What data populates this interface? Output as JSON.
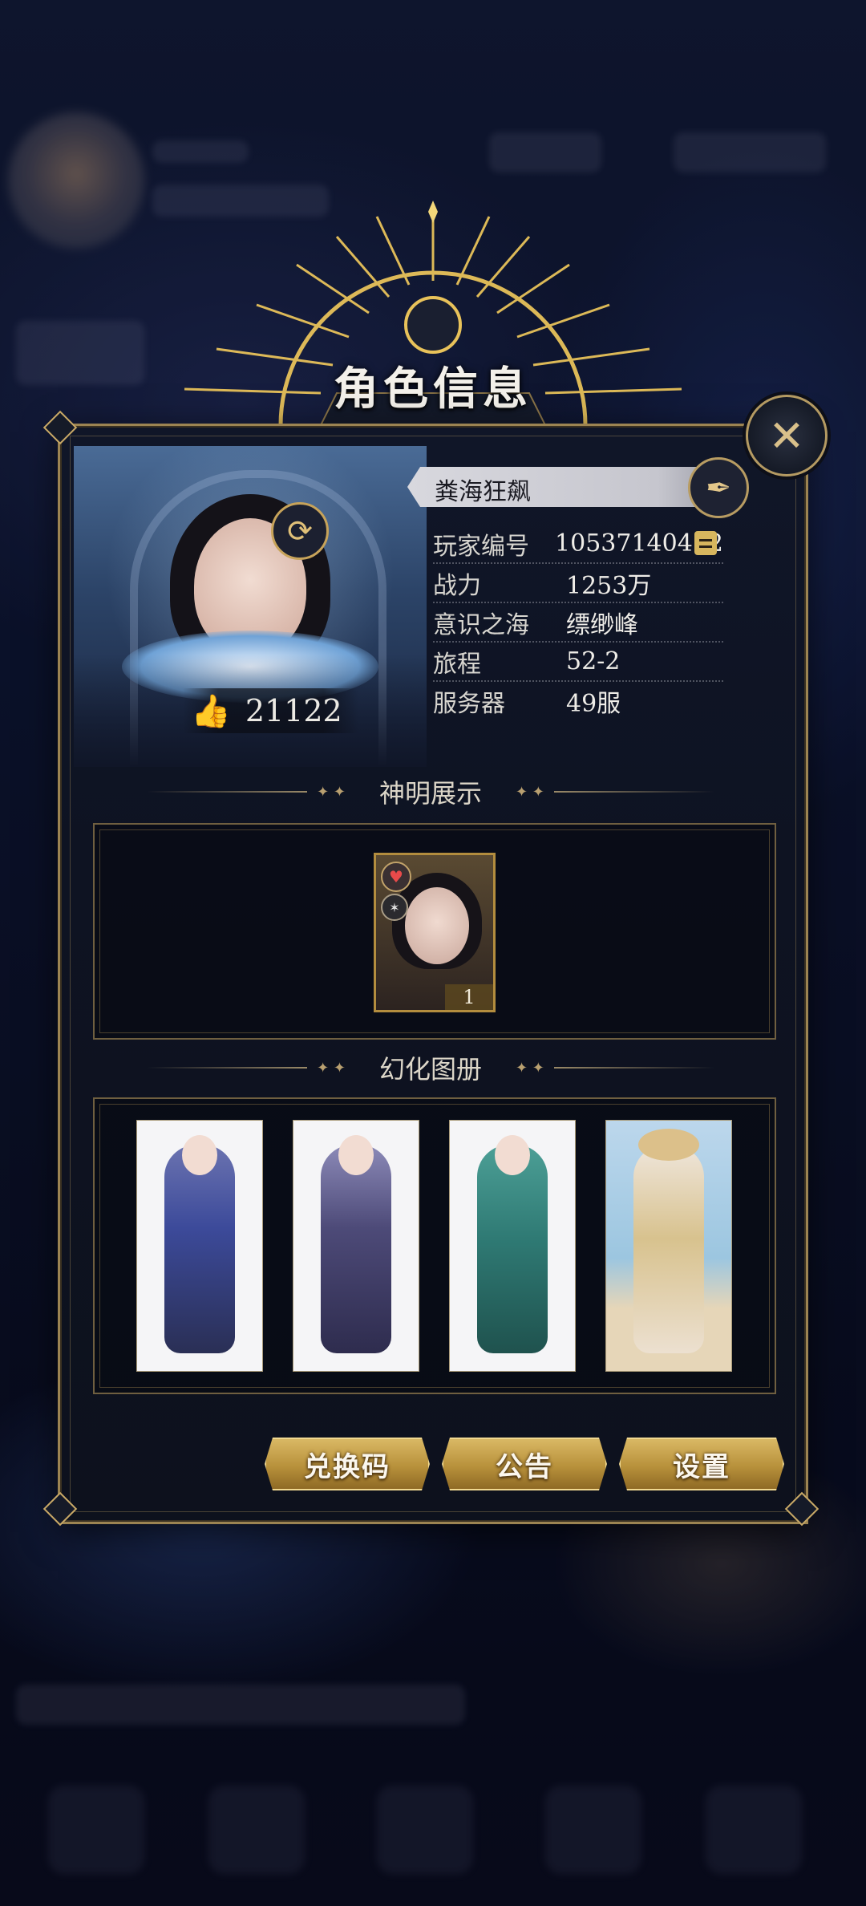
{
  "dialog": {
    "title": "角色信息",
    "close_icon": "close-x-icon"
  },
  "profile": {
    "name": "粪海狂飙",
    "likes": "21122",
    "fields": [
      {
        "label": "玩家编号",
        "value": "10537140472"
      },
      {
        "label": "战力",
        "value": "1253万"
      },
      {
        "label": "意识之海",
        "value": "缥缈峰"
      },
      {
        "label": "旅程",
        "value": "52-2"
      },
      {
        "label": "服务器",
        "value": "49服"
      }
    ]
  },
  "sections": {
    "gods": {
      "title": "神明展示",
      "card_level": "1"
    },
    "gallery": {
      "title": "幻化图册",
      "skins": [
        {
          "name": "skin-armored-knight",
          "color": "#3c4a9a"
        },
        {
          "name": "skin-violet-elf",
          "color": "#4d4a78"
        },
        {
          "name": "skin-jade-princess",
          "color": "#2f7a74"
        },
        {
          "name": "skin-beach-sunhat",
          "color": "#d8c28e"
        }
      ]
    }
  },
  "buttons": {
    "redeem": "兑换码",
    "notice": "公告",
    "settings": "设置"
  },
  "colors": {
    "gold": "#c9a966",
    "panel": "#0e1322"
  }
}
